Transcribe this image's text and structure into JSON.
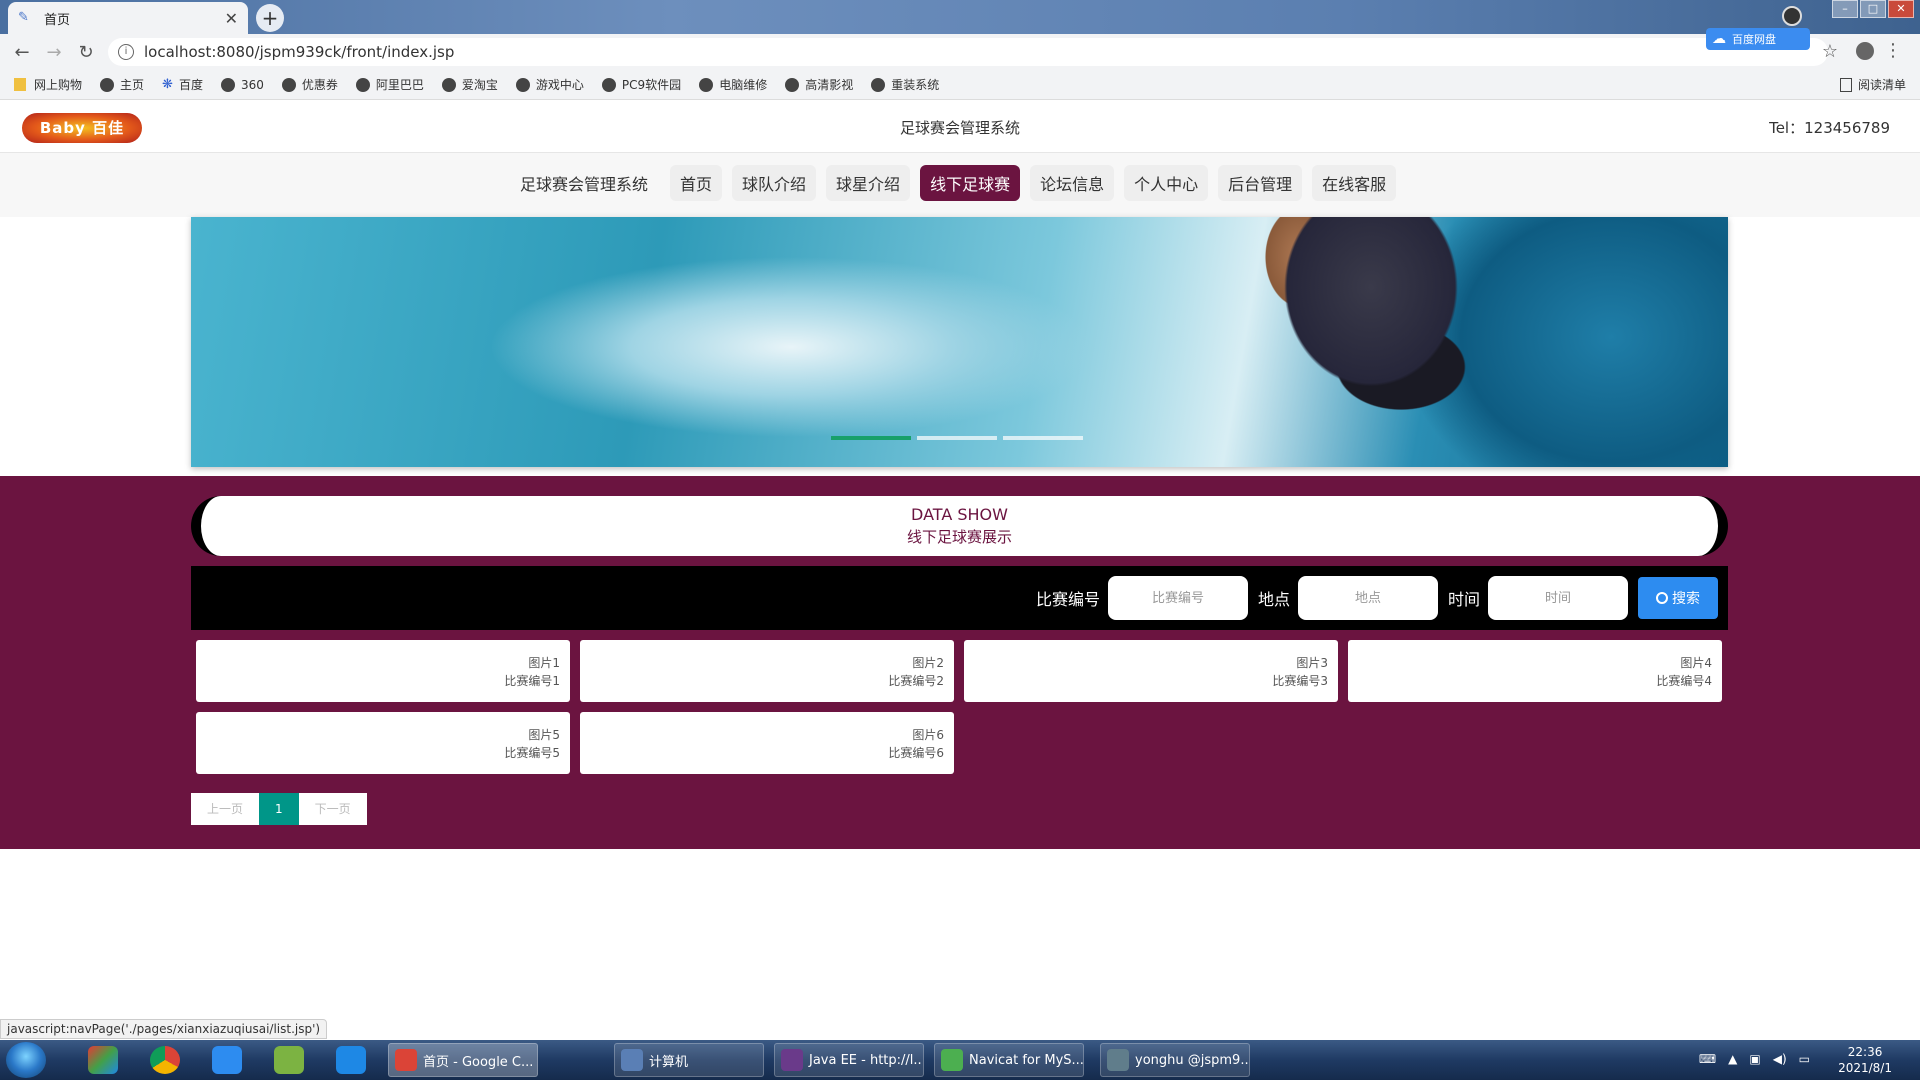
{
  "browser": {
    "tab_title": "首页",
    "tab_close": "✕",
    "new_tab": "+",
    "url": "localhost:8080/jspm939ck/front/index.jsp",
    "baidu_pill": "百度网盘",
    "bookmarks": [
      {
        "label": "网上购物",
        "icon": "folder-icon"
      },
      {
        "label": "主页",
        "icon": "globe-icon"
      },
      {
        "label": "百度",
        "icon": "paw-icon"
      },
      {
        "label": "360",
        "icon": "globe-icon"
      },
      {
        "label": "优惠券",
        "icon": "globe-icon"
      },
      {
        "label": "阿里巴巴",
        "icon": "globe-icon"
      },
      {
        "label": "爱淘宝",
        "icon": "globe-icon"
      },
      {
        "label": "游戏中心",
        "icon": "globe-icon"
      },
      {
        "label": "PC9软件园",
        "icon": "globe-icon"
      },
      {
        "label": "电脑维修",
        "icon": "globe-icon"
      },
      {
        "label": "高清影视",
        "icon": "globe-icon"
      },
      {
        "label": "重装系统",
        "icon": "globe-icon"
      }
    ],
    "reading_list": "阅读清单"
  },
  "header": {
    "logo_text": "Baby 百佳",
    "site_title": "足球赛会管理系统",
    "tel": "Tel：123456789"
  },
  "nav": {
    "brand": "足球赛会管理系统",
    "items": [
      "首页",
      "球队介绍",
      "球星介绍",
      "线下足球赛",
      "论坛信息",
      "个人中心",
      "后台管理",
      "在线客服"
    ],
    "active_index": 3
  },
  "banner": {
    "slide_count": 3,
    "active_slide": 0
  },
  "section": {
    "title_en": "DATA SHOW",
    "title_cn": "线下足球赛展示"
  },
  "search": {
    "fields": [
      {
        "label": "比赛编号",
        "placeholder": "比赛编号"
      },
      {
        "label": "地点",
        "placeholder": "地点"
      },
      {
        "label": "时间",
        "placeholder": "时间"
      }
    ],
    "button_label": "搜索"
  },
  "cards": [
    {
      "image": "图片1",
      "code": "比赛编号1"
    },
    {
      "image": "图片2",
      "code": "比赛编号2"
    },
    {
      "image": "图片3",
      "code": "比赛编号3"
    },
    {
      "image": "图片4",
      "code": "比赛编号4"
    },
    {
      "image": "图片5",
      "code": "比赛编号5"
    },
    {
      "image": "图片6",
      "code": "比赛编号6"
    }
  ],
  "pager": {
    "prev": "上一页",
    "current": "1",
    "next": "下一页"
  },
  "status_link": "javascript:navPage('./pages/xianxiazuqiusai/list.jsp')",
  "taskbar": {
    "windows": [
      {
        "label": "首页 - Google C...",
        "active": true
      },
      {
        "label": "计算机",
        "active": false
      },
      {
        "label": "Java EE - http://l...",
        "active": false
      },
      {
        "label": "Navicat for MyS...",
        "active": false
      },
      {
        "label": "yonghu @jspm9...",
        "active": false
      }
    ],
    "time": "22:36",
    "date": "2021/8/1"
  },
  "colors": {
    "accent": "#6b1440",
    "search_button": "#2d8cf0",
    "pager_current": "#009688",
    "banner_active_dot": "#18a06a"
  }
}
